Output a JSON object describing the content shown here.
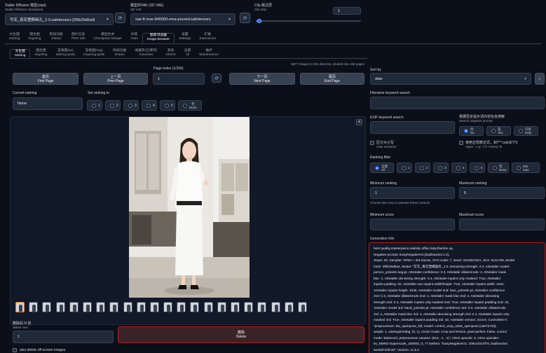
{
  "top": {
    "checkpoint_label": "Stable Diffusion 模型(ckpt)",
    "checkpoint_label_en": "Stable Diffusion checkpoint",
    "checkpoint_value": "写实_真实塑婀画孔_2.0.safetensors [2f6b29d5a4]",
    "vae_label": "模型的VAE (SD VAE)",
    "vae_label_en": "SD VAE",
    "vae_value": "vae-ft-mse-840000-ema-pruned.safetensors",
    "clip_label": "Clip 跳过层",
    "clip_label_en": "Clip skip",
    "clip_value": "1",
    "clip_fraction": 0.02,
    "refresh_icon": "refresh-icon"
  },
  "main_tabs": [
    {
      "cn": "文生图",
      "en": "txt2img"
    },
    {
      "cn": "图生图",
      "en": "img2img"
    },
    {
      "cn": "附加功能",
      "en": "Extras"
    },
    {
      "cn": "图片信息",
      "en": "PNG Info"
    },
    {
      "cn": "模型合并",
      "en": "Checkpoint Merger"
    },
    {
      "cn": "训练",
      "en": "Train"
    },
    {
      "cn": "图库浏览器",
      "en": "Image Browser"
    },
    {
      "cn": "设置",
      "en": "Settings"
    },
    {
      "cn": "扩展",
      "en": "Extensions"
    }
  ],
  "sub_tabs": [
    {
      "cn": "文生图",
      "en": "txt2img"
    },
    {
      "cn": "图生图",
      "en": "img2img"
    },
    {
      "cn": "宫格图(txt)",
      "en": "txt2img-grids"
    },
    {
      "cn": "宫格图(img)",
      "en": "img2img-grids"
    },
    {
      "cn": "附加功能",
      "en": "Extras"
    },
    {
      "cn": "收藏夹(已保存)",
      "en": "Favorites"
    },
    {
      "cn": "其他",
      "en": "Others"
    },
    {
      "cn": "全部",
      "en": "All"
    },
    {
      "cn": "维护",
      "en": "Maintenance"
    }
  ],
  "info_line": "6877 images in this directory, divided into 166 pages",
  "nav": {
    "first": {
      "cn": "首页",
      "en": "First Page"
    },
    "prev": {
      "cn": "上一页",
      "en": "Prev Page"
    },
    "page_index_label": "Page Index (1/166)",
    "page_index_value": "1",
    "next": {
      "cn": "下一页",
      "en": "Next Page"
    },
    "end": {
      "cn": "尾页",
      "en": "End Page"
    }
  },
  "current_ranking": {
    "label": "Current ranking",
    "value": "None"
  },
  "set_ranking": {
    "label": "Set ranking to",
    "options": [
      "1",
      "2",
      "3",
      "4",
      "5"
    ],
    "none_cn": "无",
    "none_en": "None"
  },
  "close_glyph": "×",
  "thumbnail_count": 22,
  "delete_next": {
    "label_cn": "删除后 N 张",
    "label_en": "delete next",
    "value": "1"
  },
  "delete_btn": {
    "cn": "删除",
    "en": "Delete"
  },
  "also_delete": "also delete off-screen images",
  "right": {
    "sort_label": "Sort by",
    "sort_value": "date",
    "sort_arrow": "↓",
    "filename_label": "Filename keyword search",
    "exif_label": "EXIF keyword search",
    "negative_label_cn": "根据否定提示词内容包含搜索",
    "negative_label_en": "Search negative prompt",
    "negative_options": [
      {
        "cn": "否",
        "en": "No"
      },
      {
        "cn": "是",
        "en": "Yes"
      },
      {
        "cn": "只有",
        "en": "Only"
      }
    ],
    "case_cn": "区分大小写",
    "case_en": "case sensitive",
    "regex_cn": "使用正则表达式，如*!\"^cake$\"(*S",
    "regex_en": "regex - e.g. ^(?!.*Hires).*$",
    "ranking_filter_label": "Ranking filter",
    "ranking_filter_options": [
      {
        "cn": "全部",
        "en": "All"
      },
      {
        "cn": "",
        "en": "1"
      },
      {
        "cn": "",
        "en": "2"
      },
      {
        "cn": "",
        "en": "3"
      },
      {
        "cn": "",
        "en": "4"
      },
      {
        "cn": "",
        "en": "5"
      },
      {
        "cn": "无",
        "en": "None"
      },
      {
        "cn": "",
        "en": "Min-max"
      }
    ],
    "min_ranking_label": "Minimum ranking",
    "min_ranking_value": "1",
    "max_ranking_label": "Maximum ranking",
    "max_ranking_value": "5",
    "minmax_hint": "Choose Min-max to activate these controls",
    "min_score_label": "Minimum score",
    "max_score_label": "Maximum score",
    "gen_info_label": "Generation Info",
    "gen_info_lines": [
      "best quality,masterpiece,realistic,office lady,thumbs up,",
      "Negative prompt: EasyNegativeV2,(badhandv4:1.2),",
      "Steps: 30, Sampler: DPM++ 2M Karras, CFG scale: 7, Seed: 3324947641, Size: 512x768, Model",
      "hash: 2f6b29d5a4, Model: \"写实_真实塑婀画孔_2.0, Denoising strength: 0.2, ADetailer model:",
      "person_yolov8n-seg.pt, ADetailer confidence: 0.3, ADetailer dilate/erode: 4, ADetailer mask",
      "blur: 4, ADetailer denoising strength: 0.4, ADetailer inpaint only masked: True, ADetailer",
      "inpaint padding: 32, ADetailer use inpaint width/height: True, ADetailer inpaint width: 1024,",
      "ADetailer inpaint height: 1536, ADetailer model 2nd: face_yolov8n.pt, ADetailer confidence",
      "2nd: 0.3, ADetailer dilate/erode 2nd: 4, ADetailer mask blur 2nd: 4, ADetailer denoising",
      "strength 2nd: 0.4, ADetailer inpaint only masked 2nd: True, ADetailer inpaint padding 2nd: 32,",
      "ADetailer model 3rd: hand_yolov8n.pt, ADetailer confidence 3rd: 0.3, ADetailer dilate/erode",
      "3rd: 4, ADetailer mask blur 3rd: 4, ADetailer denoising strength 3rd: 0.4, ADetailer inpaint only",
      "masked 3rd: True, ADetailer inpaint padding 3rd: 32, ADetailer version: 23.8.9, ControlNet 0:",
      "\"preprocessor: dw_openpose_full, model: control_v11p_sd15_openpose [cab727d4],",
      "weight: 1, starting/ending: (0, 1), resize mode: Crop and Resize, pixel perfect: False, control",
      "mode: Balanced, preprocessor params: (512, -1, -1)\", Hires upscale: 2, Hires upscaler:",
      "8x_NMKD-Superscale_150000_G, TI hashes: \"EasyNegativeV2: 339cc9210f70, badhandv4:",
      "5e40d722fc3d\", Version: v1.5.2"
    ]
  }
}
